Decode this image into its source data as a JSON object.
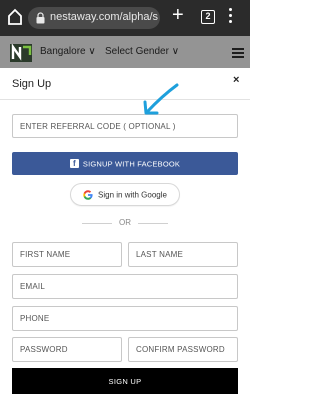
{
  "browser": {
    "url": "nestaway.com/alpha/sig",
    "tab_count": "2"
  },
  "site_header": {
    "city": "Bangalore ∨",
    "gender": "Select Gender ∨"
  },
  "modal": {
    "title": "Sign Up",
    "close_label": "×",
    "referral_placeholder": "ENTER REFERRAL CODE ( OPTIONAL )",
    "facebook_label": "SIGNUP WITH FACEBOOK",
    "google_label": "Sign in with Google",
    "or_label": "OR",
    "first_name_placeholder": "FIRST NAME",
    "last_name_placeholder": "LAST NAME",
    "email_placeholder": "EMAIL",
    "phone_placeholder": "PHONE",
    "password_placeholder": "PASSWORD",
    "confirm_password_placeholder": "CONFIRM PASSWORD",
    "signup_label": "SIGN UP"
  },
  "colors": {
    "facebook_blue": "#3b5998",
    "annotation_arrow": "#1ea0dc",
    "signup_button": "#000000"
  }
}
